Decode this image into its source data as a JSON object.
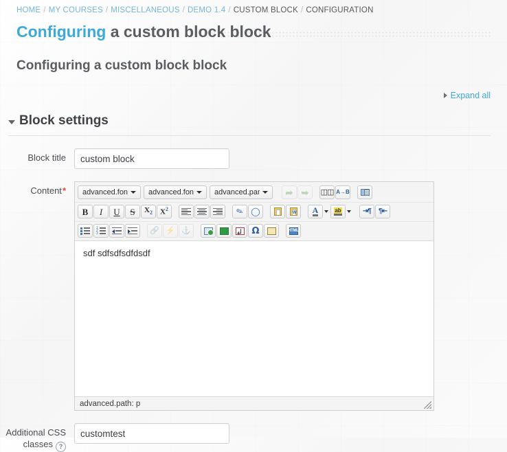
{
  "breadcrumb": {
    "items": [
      {
        "label": "HOME",
        "link": true
      },
      {
        "label": "MY COURSES",
        "link": true
      },
      {
        "label": "MISCELLANEOUS",
        "link": true
      },
      {
        "label": "DEMO 1.4",
        "link": true
      },
      {
        "label": "CUSTOM BLOCK",
        "link": false
      },
      {
        "label": "CONFIGURATION",
        "link": false
      }
    ],
    "separator": "/"
  },
  "page": {
    "title_highlight": "Configuring",
    "title_rest": "a custom block block",
    "sub_title": "Configuring a custom block block"
  },
  "expand": {
    "label": "Expand all"
  },
  "section": {
    "title": "Block settings"
  },
  "form": {
    "block_title": {
      "label": "Block title",
      "value": "custom block"
    },
    "content": {
      "label": "Content",
      "required_marker": "*",
      "body_text": "sdf sdfsdfsdfdsdf",
      "status_path": "advanced.path: p"
    },
    "css_classes": {
      "label_line1": "Additional CSS",
      "label_line2": "classes",
      "help_glyph": "?",
      "value": "customtest"
    }
  },
  "editor": {
    "selects": [
      {
        "name": "font-select-1",
        "value": "advanced.font"
      },
      {
        "name": "font-select-2",
        "value": "advanced.font"
      },
      {
        "name": "paragraph-select",
        "value": "advanced.par"
      }
    ],
    "row1_buttons": [
      {
        "name": "undo-button",
        "title": "Undo",
        "disabled": true
      },
      {
        "name": "redo-button",
        "title": "Redo",
        "disabled": true
      },
      {
        "name": "search-button",
        "title": "Find",
        "disabled": false
      },
      {
        "name": "replace-button",
        "title": "Find and replace",
        "disabled": false
      },
      {
        "name": "template-button",
        "title": "Insert template",
        "disabled": false
      }
    ],
    "row2_buttons": [
      {
        "name": "bold-button",
        "title": "Bold",
        "glyph": "B"
      },
      {
        "name": "italic-button",
        "title": "Italic",
        "glyph": "I"
      },
      {
        "name": "underline-button",
        "title": "Underline",
        "glyph": "U"
      },
      {
        "name": "strikethrough-button",
        "title": "Strikethrough",
        "glyph": "S"
      },
      {
        "name": "subscript-button",
        "title": "Subscript",
        "glyph": "X2"
      },
      {
        "name": "superscript-button",
        "title": "Superscript",
        "glyph": "X2"
      },
      {
        "name": "align-left-button",
        "title": "Align left"
      },
      {
        "name": "align-center-button",
        "title": "Align center"
      },
      {
        "name": "align-right-button",
        "title": "Align right"
      },
      {
        "name": "cleanup-button",
        "title": "Cleanup messy code"
      },
      {
        "name": "remove-format-button",
        "title": "Remove formatting"
      },
      {
        "name": "paste-button",
        "title": "Paste as plain text"
      },
      {
        "name": "paste-word-button",
        "title": "Paste from Word"
      },
      {
        "name": "forecolor-button",
        "title": "Text colour",
        "glyph": "A"
      },
      {
        "name": "backcolor-button",
        "title": "Background colour",
        "glyph": "ab"
      },
      {
        "name": "ltr-button",
        "title": "Left to right"
      },
      {
        "name": "rtl-button",
        "title": "Right to left"
      }
    ],
    "row3_buttons": [
      {
        "name": "bullet-list-button",
        "title": "Unordered list"
      },
      {
        "name": "numbered-list-button",
        "title": "Ordered list"
      },
      {
        "name": "outdent-button",
        "title": "Outdent"
      },
      {
        "name": "indent-button",
        "title": "Indent"
      },
      {
        "name": "link-button",
        "title": "Insert link",
        "disabled": true
      },
      {
        "name": "unlink-button",
        "title": "Unlink",
        "disabled": true
      },
      {
        "name": "anchor-button",
        "title": "Insert anchor",
        "disabled": true
      },
      {
        "name": "image-button",
        "title": "Insert image"
      },
      {
        "name": "media-button",
        "title": "Insert media"
      },
      {
        "name": "nonbreaking-button",
        "title": "Insert non-breaking space"
      },
      {
        "name": "special-char-button",
        "title": "Insert special character",
        "glyph": "Ω"
      },
      {
        "name": "equation-button",
        "title": "Equation editor"
      },
      {
        "name": "html-button",
        "title": "Edit HTML source",
        "glyph": "HTML"
      }
    ]
  },
  "colors": {
    "accent": "#3ca9d9",
    "link": "#74b6d6",
    "required": "#e0483b",
    "text": "#4a4d51",
    "heading": "#5a5d61"
  }
}
